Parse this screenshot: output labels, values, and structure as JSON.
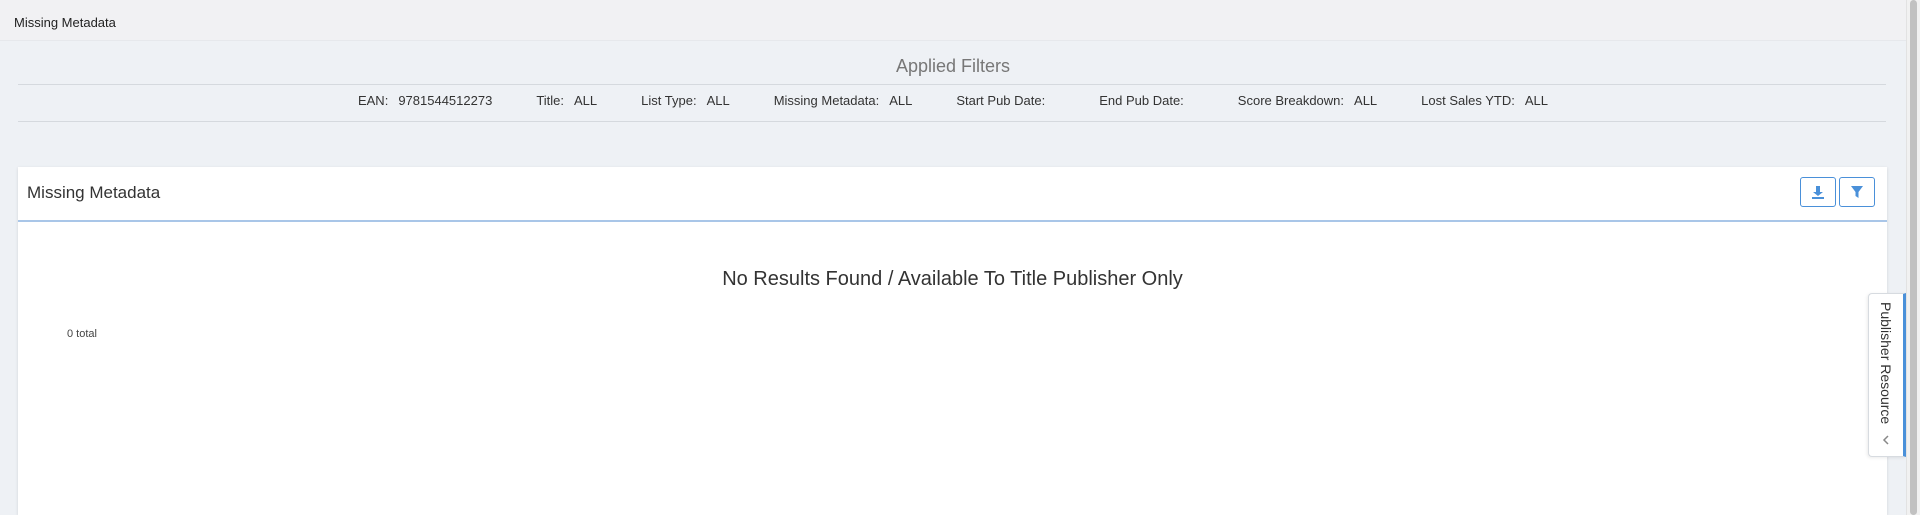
{
  "breadcrumb": "Missing Metadata",
  "applied_filters": {
    "title": "Applied Filters",
    "items": [
      {
        "label": "EAN:",
        "value": "9781544512273"
      },
      {
        "label": "Title:",
        "value": "ALL"
      },
      {
        "label": "List Type:",
        "value": "ALL"
      },
      {
        "label": "Missing Metadata:",
        "value": "ALL"
      },
      {
        "label": "Start Pub Date:",
        "value": ""
      },
      {
        "label": "End Pub Date:",
        "value": ""
      },
      {
        "label": "Score Breakdown:",
        "value": "ALL"
      },
      {
        "label": "Lost Sales YTD:",
        "value": "ALL"
      }
    ]
  },
  "panel": {
    "title": "Missing Metadata",
    "download_icon": "download-icon",
    "filter_icon": "filter-icon",
    "no_results": "No Results Found / Available To Title Publisher Only",
    "total": "0 total"
  },
  "side_tab": {
    "label": "Publisher Resource",
    "chevron_icon": "chevron-left-icon"
  },
  "colors": {
    "accent": "#4a90d9",
    "background": "#eef1f5"
  }
}
